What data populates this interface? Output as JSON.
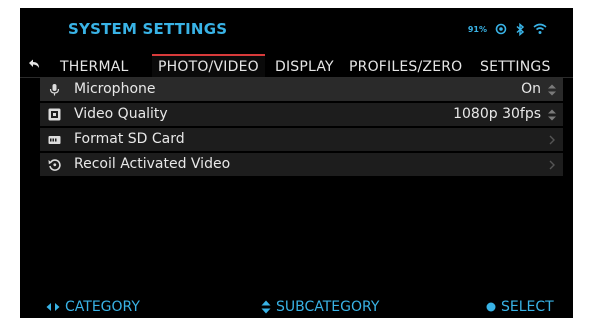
{
  "header": {
    "title": "SYSTEM SETTINGS",
    "battery": "91%",
    "status_icons": [
      "battery-icon",
      "record-indicator-icon",
      "bluetooth-icon",
      "wifi-icon"
    ]
  },
  "tabs": [
    {
      "label": "THERMAL",
      "active": false
    },
    {
      "label": "PHOTO/VIDEO",
      "active": true
    },
    {
      "label": "DISPLAY",
      "active": false
    },
    {
      "label": "PROFILES/ZERO",
      "active": false
    },
    {
      "label": "SETTINGS",
      "active": false
    }
  ],
  "menu": [
    {
      "icon": "microphone-icon",
      "label": "Microphone",
      "value": "On",
      "control": "stepper-icon"
    },
    {
      "icon": "video-quality-icon",
      "label": "Video Quality",
      "value": "1080p 30fps",
      "control": "stepper-icon"
    },
    {
      "icon": "sd-card-icon",
      "label": "Format SD Card",
      "value": "",
      "control": "chevron-right-icon"
    },
    {
      "icon": "recoil-icon",
      "label": "Recoil Activated Video",
      "value": "",
      "control": "chevron-right-icon"
    }
  ],
  "footer": {
    "category": "CATEGORY",
    "subcategory": "SUBCATEGORY",
    "select": "SELECT"
  },
  "colors": {
    "accent": "#39b3e6",
    "active_tab": "#d83b3b",
    "row_bg": "#1d1d1d",
    "background": "#000000"
  }
}
